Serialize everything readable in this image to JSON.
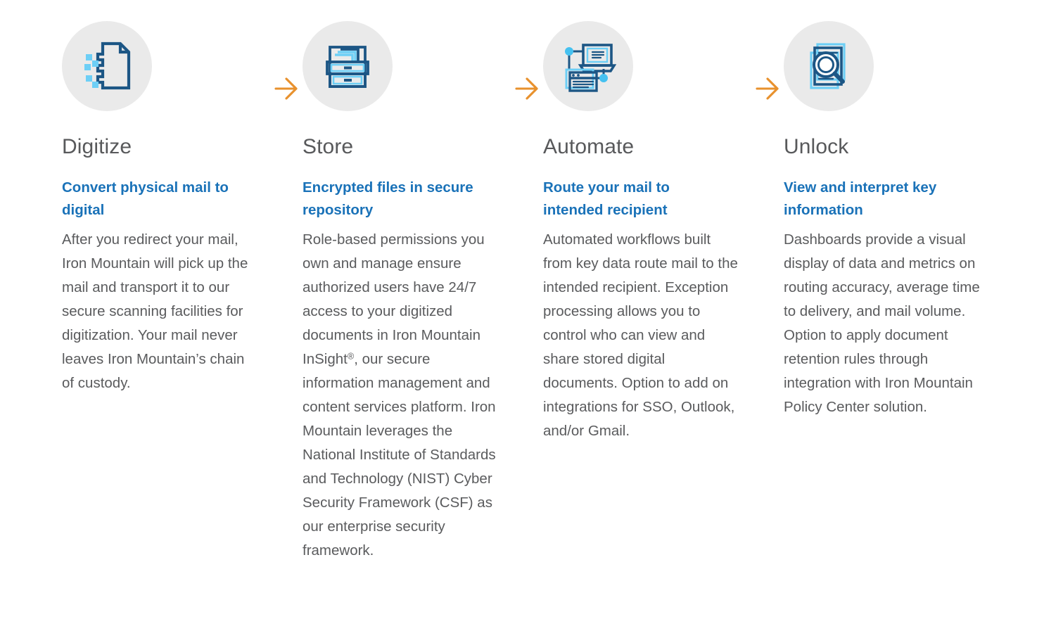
{
  "theme": {
    "circle_bg": "#eaeaea",
    "title_color": "#58595b",
    "subhead_color": "#1a72b8",
    "body_color": "#5a5b5d",
    "arrow_color": "#e8912d",
    "icon_dark": "#1c5685",
    "icon_light": "#6dcff6",
    "page_bg": "#ffffff"
  },
  "steps": [
    {
      "icon": "digitize-document-icon",
      "title": "Digitize",
      "subhead": "Convert physical mail to digital",
      "body_pre": "After you redirect your mail, Iron Mountain will pick up the mail and transport it to our secure scanning facilities for digitization. Your mail never leaves Iron Mountain’s chain of custody.",
      "body_sup": "",
      "body_post": ""
    },
    {
      "icon": "filing-cabinet-icon",
      "title": "Store",
      "subhead": "Encrypted files in secure repository",
      "body_pre": "Role-based permissions you own and manage ensure authorized users have 24/7 access to your digitized documents in Iron Mountain InSight",
      "body_sup": "®",
      "body_post": ", our secure information management and content services platform. Iron Mountain leverages the National Institute of Standards and Technology (NIST) Cyber Security Framework (CSF) as our enterprise security framework."
    },
    {
      "icon": "workflow-automation-icon",
      "title": "Automate",
      "subhead": "Route your mail to intended recipient",
      "body_pre": "Automated workflows built from key data route mail to the intended recipient. Exception processing allows you to control who can view and share stored digital documents. Option to add on integrations for SSO, Outlook, and/or Gmail.",
      "body_sup": "",
      "body_post": ""
    },
    {
      "icon": "document-search-icon",
      "title": "Unlock",
      "subhead": "View and interpret key information",
      "body_pre": "Dashboards provide a visual display of data and metrics on routing accuracy, average time to delivery, and mail volume. Option to apply document retention rules through integration with Iron Mountain Policy Center solution.",
      "body_sup": "",
      "body_post": ""
    }
  ],
  "arrows": [
    {
      "name": "arrow-digitize-to-store"
    },
    {
      "name": "arrow-store-to-automate"
    },
    {
      "name": "arrow-automate-to-unlock"
    }
  ]
}
